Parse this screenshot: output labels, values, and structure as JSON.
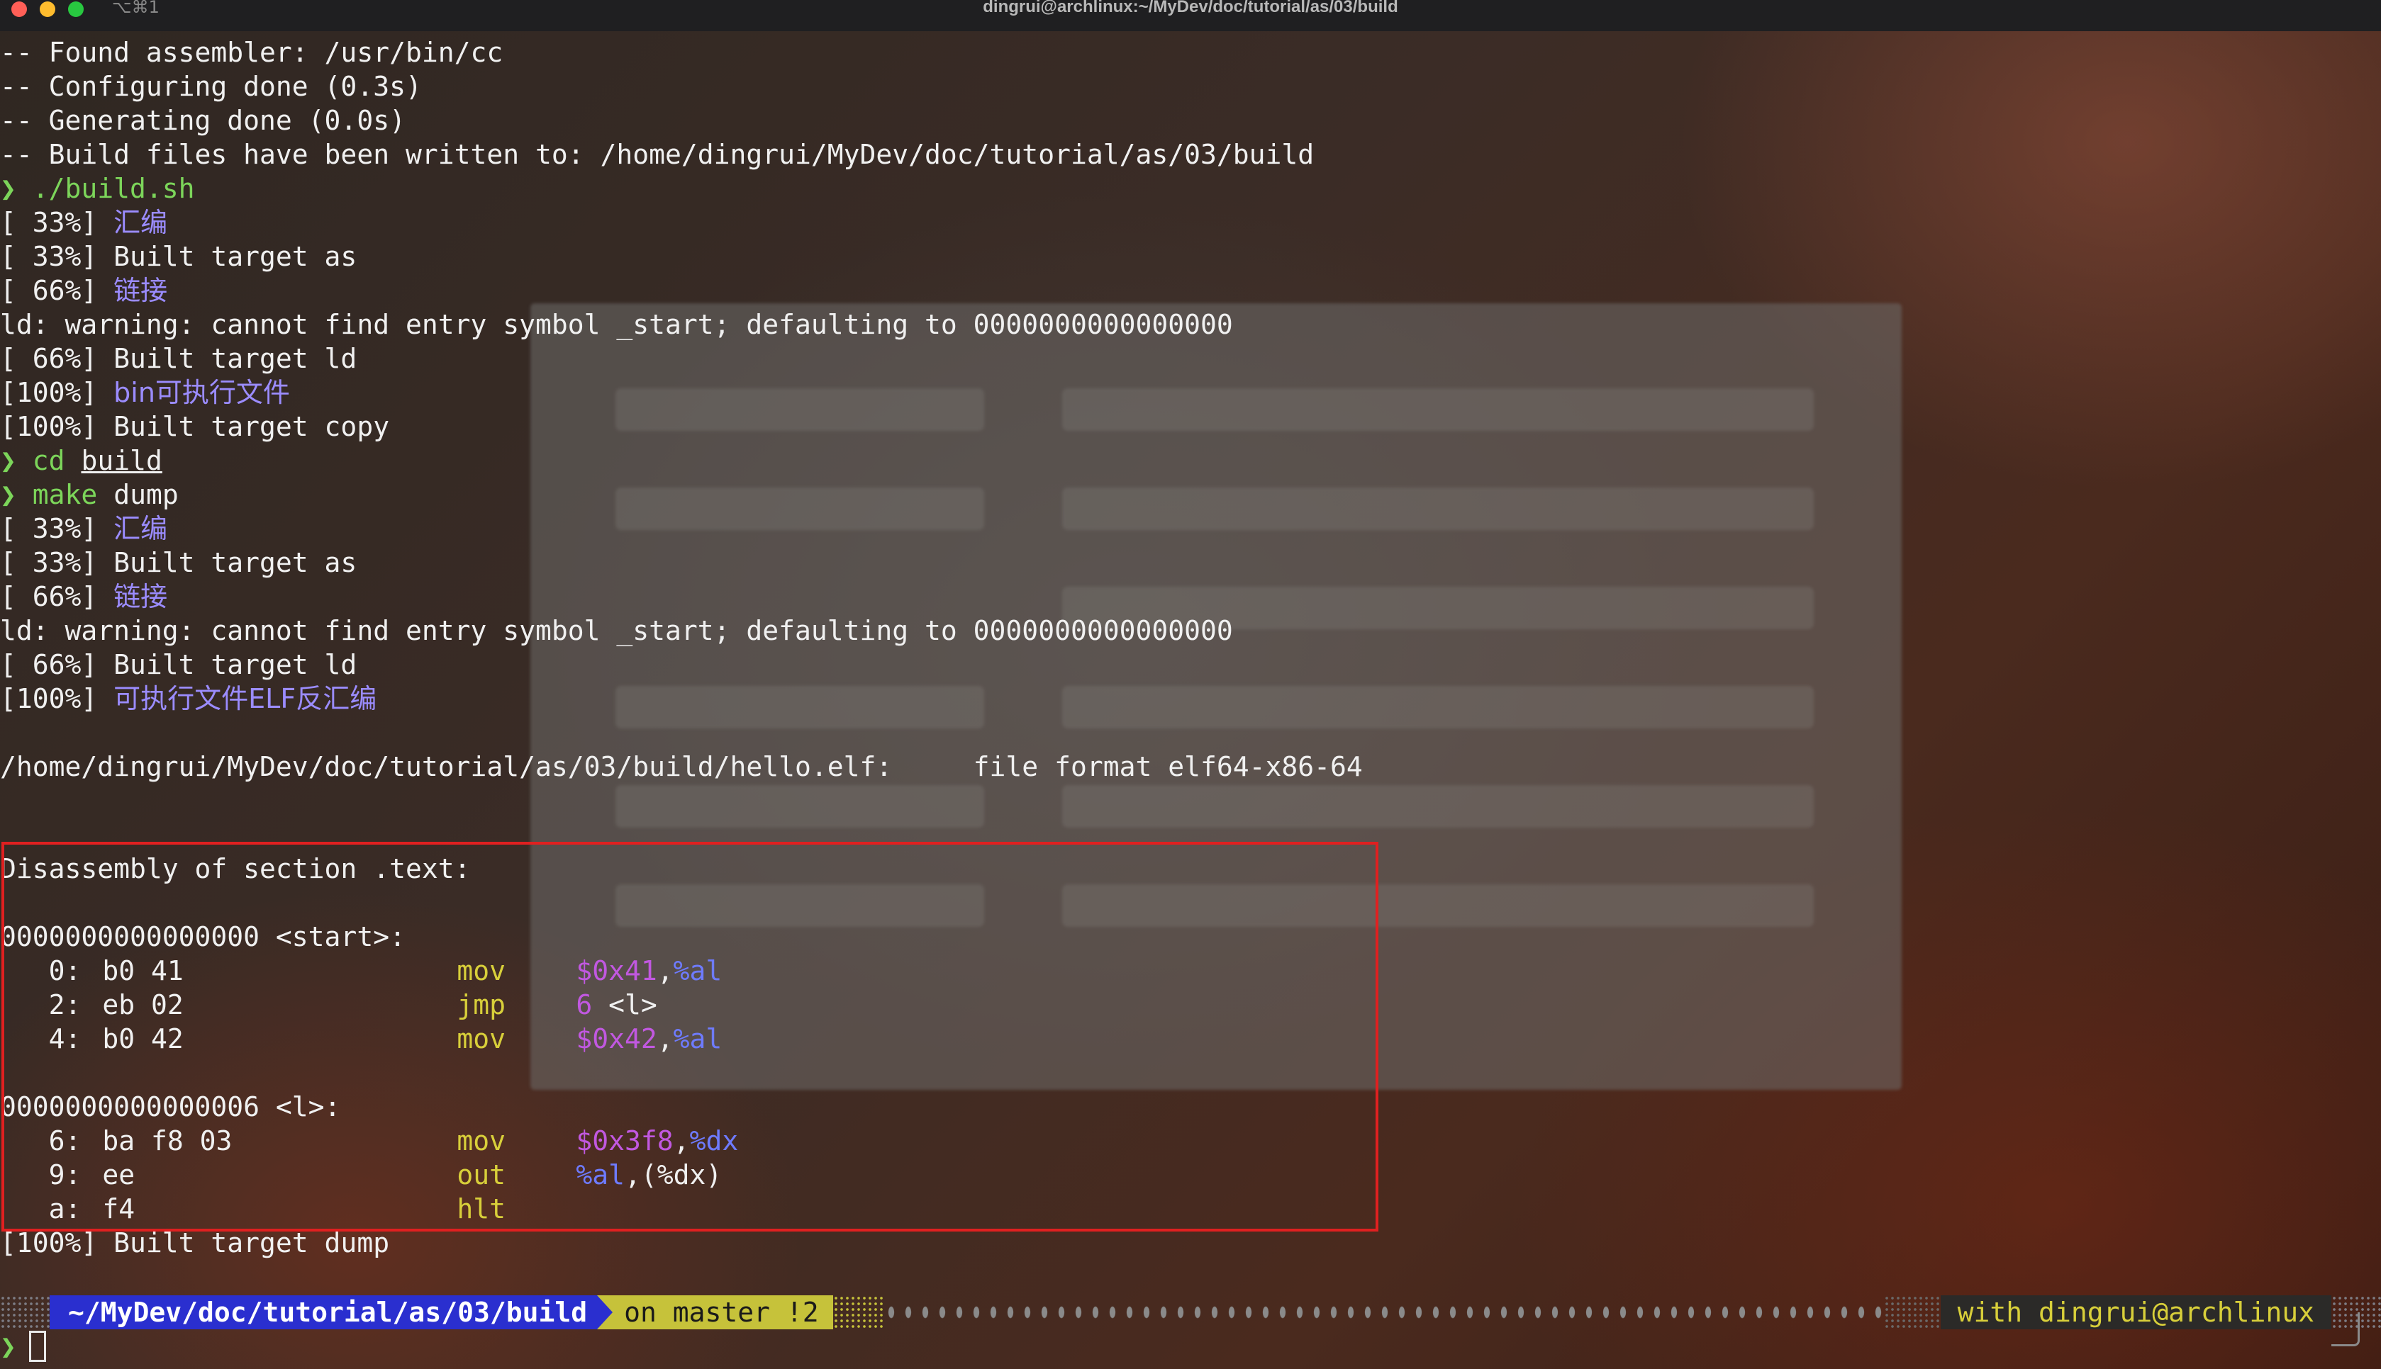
{
  "window": {
    "title": "dingrui@archlinux:~/MyDev/doc/tutorial/as/03/build",
    "tab_shortcut": "⌥⌘1"
  },
  "terminal_lines": [
    {
      "text": "-- Found assembler: /usr/bin/cc"
    },
    {
      "text": "-- Configuring done (0.3s)"
    },
    {
      "text": "-- Generating done (0.0s)"
    },
    {
      "text": "-- Build files have been written to: /home/dingrui/MyDev/doc/tutorial/as/03/build"
    },
    {
      "prompt": "❯",
      "cmd": "./build.sh"
    },
    {
      "prefix": "[ 33%] ",
      "cjk": "汇编"
    },
    {
      "text": "[ 33%] Built target as"
    },
    {
      "prefix": "[ 66%] ",
      "cjk": "链接"
    },
    {
      "text": "ld: warning: cannot find entry symbol _start; defaulting to 0000000000000000"
    },
    {
      "text": "[ 66%] Built target ld"
    },
    {
      "prefix": "[100%] ",
      "cjk": "bin可执行文件"
    },
    {
      "text": "[100%] Built target copy"
    },
    {
      "prompt": "❯",
      "cmd": "cd",
      "arg": "build"
    },
    {
      "prompt": "❯",
      "cmd": "make",
      "arg_plain": "dump"
    },
    {
      "prefix": "[ 33%] ",
      "cjk": "汇编"
    },
    {
      "text": "[ 33%] Built target as"
    },
    {
      "prefix": "[ 66%] ",
      "cjk": "链接"
    },
    {
      "text": "ld: warning: cannot find entry symbol _start; defaulting to 0000000000000000"
    },
    {
      "text": "[ 66%] Built target ld"
    },
    {
      "prefix": "[100%] ",
      "cjk": "可执行文件ELF反汇编"
    },
    {
      "text": ""
    },
    {
      "text": "/home/dingrui/MyDev/doc/tutorial/as/03/build/hello.elf:     file format elf64-x86-64"
    },
    {
      "text": ""
    },
    {
      "text": ""
    },
    {
      "text": "Disassembly of section .text:"
    },
    {
      "text": ""
    },
    {
      "text": "0000000000000000 <start>:"
    },
    {
      "asm": {
        "addr": "   0:",
        "bytes": "b0 41",
        "op": "mov",
        "imm": "$0x41",
        "sep": ",",
        "reg": "%al",
        "rest": ""
      }
    },
    {
      "asm": {
        "addr": "   2:",
        "bytes": "eb 02",
        "op": "jmp",
        "imm": "6",
        "sep": "",
        "reg": "",
        "rest": " <l>"
      }
    },
    {
      "asm": {
        "addr": "   4:",
        "bytes": "b0 42",
        "op": "mov",
        "imm": "$0x42",
        "sep": ",",
        "reg": "%al",
        "rest": ""
      }
    },
    {
      "text": ""
    },
    {
      "text": "0000000000000006 <l>:"
    },
    {
      "asm": {
        "addr": "   6:",
        "bytes": "ba f8 03",
        "op": "mov",
        "imm": "$0x3f8",
        "sep": ",",
        "reg": "%dx",
        "rest": ""
      }
    },
    {
      "asm": {
        "addr": "   9:",
        "bytes": "ee",
        "op": "out",
        "imm": "",
        "sep": "",
        "reg": "%al",
        "rest": ",(%dx)"
      }
    },
    {
      "asm": {
        "addr": "   a:",
        "bytes": "f4",
        "op": "hlt",
        "imm": "",
        "sep": "",
        "reg": "",
        "rest": ""
      }
    },
    {
      "text": "[100%] Built target dump"
    }
  ],
  "prompt_bar": {
    "path": "~/MyDev/doc/tutorial/as/03/build",
    "git": "on master !2",
    "user": "with dingrui@archlinux"
  },
  "input": {
    "prompt": "❯"
  },
  "colors": {
    "accent_green": "#7cd55a",
    "cjk_purple": "#9b8cff",
    "asm_opcode": "#d8cf3a",
    "asm_immediate": "#c158e0",
    "asm_register": "#6e7bff",
    "highlight_box": "#e02020",
    "path_segment": "#2a2fcf",
    "git_segment": "#c6c23a"
  }
}
